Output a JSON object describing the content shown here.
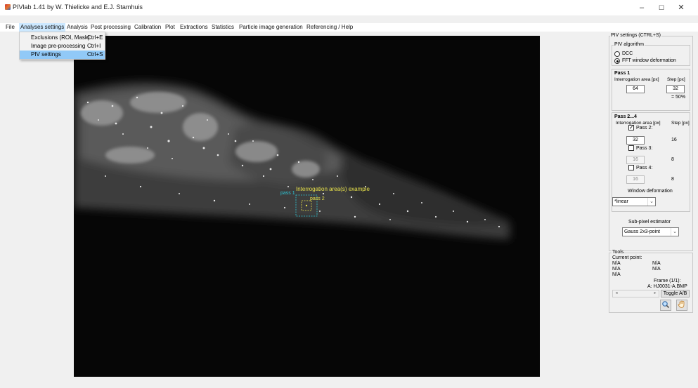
{
  "window": {
    "title": "PIVlab 1.41 by W. Thielicke and E.J. Stamhuis",
    "minimize": "–",
    "maximize": "☐",
    "close": "✕"
  },
  "menu": {
    "file": "File",
    "analyses_settings": "Analyses settings",
    "analysis": "Analysis",
    "post_processing": "Post processing",
    "calibration": "Calibration",
    "plot": "Plot",
    "extractions": "Extractions",
    "statistics": "Statistics",
    "particle_image_generation": "Particle image generation",
    "referencing_help": "Referencing / Help"
  },
  "dropdown": [
    {
      "label": "Exclusions (ROI, Mask)",
      "shortcut": "Ctrl+E"
    },
    {
      "label": "Image pre-processing",
      "shortcut": "Ctrl+I"
    },
    {
      "label": "PIV settings",
      "shortcut": "Ctrl+S"
    }
  ],
  "overlay": {
    "pass1_label": "pass 1",
    "example_label": "Interrogation area(s) example",
    "pass2_label": "pass 2"
  },
  "panel": {
    "title": "PIV settings (CTRL+S)",
    "algorithm": {
      "title": "PIV algorithm",
      "dcc": "DCC",
      "fft": "FFT window deformation",
      "selected": "FFT window deformation"
    },
    "pass1": {
      "title": "Pass 1",
      "area_label": "Interrogation area [px]",
      "step_label": "Step [px]",
      "area": "64",
      "step": "32",
      "overlap": "= 50%"
    },
    "pass2_4": {
      "title": "Pass 2...4",
      "area_label": "Interrogation area [px]",
      "step_label": "Step [px]",
      "pass2_label": "Pass 2:",
      "pass2_checked": true,
      "pass2_area": "32",
      "pass2_step": "16",
      "pass3_label": "Pass 3:",
      "pass3_area": "16",
      "pass3_step": "8",
      "pass4_label": "Pass 4:",
      "pass4_area": "16",
      "pass4_step": "8",
      "window_deformation_label": "Window deformation",
      "window_deformation_value": "*linear"
    },
    "subpixel": {
      "label": "Sub-pixel estimator",
      "value": "Gauss 2x3-point"
    }
  },
  "tools": {
    "title": "Tools",
    "current_point": "Current point:",
    "na1": "N/A",
    "na2": "N/A",
    "na3": "N/A",
    "na4": "N/A",
    "na5": "N/A",
    "frame": "Frame (1/1):",
    "filename": "A: HJ0031-A.BMP",
    "toggle": "Toggle A/B",
    "zoom_icon": "magnifier-icon",
    "pan_icon": "hand-icon"
  },
  "colors": {
    "menu_highlight": "#cce8ff",
    "dropdown_selected": "#91c9f7",
    "overlay_yellow": "#e8e24a",
    "overlay_cyan": "#2ec8d8"
  }
}
